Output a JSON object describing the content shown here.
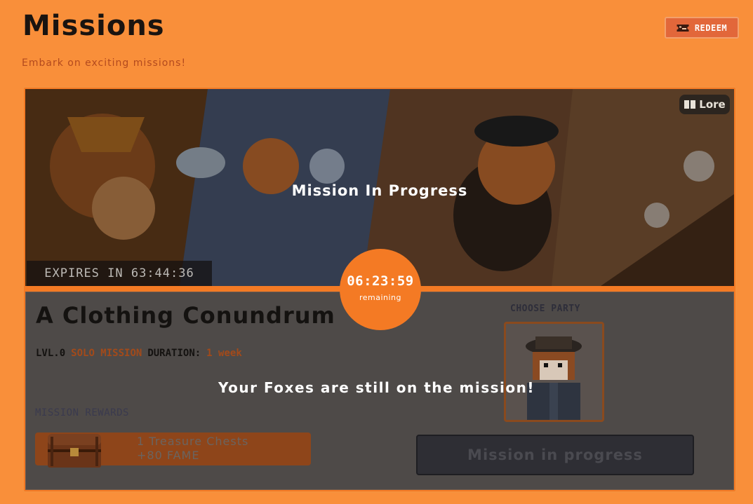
{
  "header": {
    "title": "Missions",
    "subtitle": "Embark on exciting missions!",
    "redeem_label": "REDEEM",
    "redeem_icon": "ticket-icon"
  },
  "mission": {
    "banner": {
      "lore_label": "Lore",
      "lore_icon": "book-icon",
      "status_title": "Mission In Progress",
      "expires_text": "EXPIRES IN 63:44:36"
    },
    "timer": {
      "value": "06:23:59",
      "label": "remaining"
    },
    "name": "A Clothing Conundrum",
    "level": "LVL.0",
    "type": "SOLO MISSION",
    "duration_label": "DURATION:",
    "duration_value": "1 week",
    "rewards_label": "MISSION REWARDS",
    "rewards": [
      "1 Treasure Chests",
      "+80 FAME"
    ],
    "choose_party_label": "CHOOSE PARTY",
    "progress_button": "Mission in progress",
    "overlay_message": "Your Foxes are still on the mission!"
  },
  "colors": {
    "background": "#f98f3a",
    "accent": "#f47a24",
    "redeem": "#e2673a"
  }
}
